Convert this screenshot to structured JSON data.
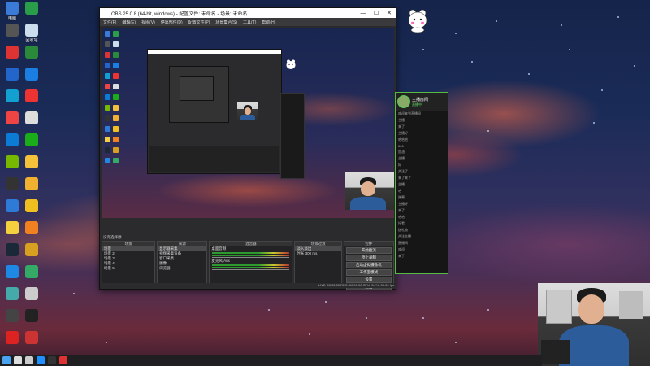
{
  "desktop": {
    "icons": [
      {
        "label": "电脑",
        "color": "#3b7bd8"
      },
      {
        "label": "",
        "color": "#2a9d4a"
      },
      {
        "label": "",
        "color": "#555"
      },
      {
        "label": "回收站",
        "color": "#cde"
      },
      {
        "label": "",
        "color": "#d33"
      },
      {
        "label": "",
        "color": "#2a8a3a"
      },
      {
        "label": "",
        "color": "#2266cc"
      },
      {
        "label": "",
        "color": "#1a7fe0"
      },
      {
        "label": "",
        "color": "#12a0d0"
      },
      {
        "label": "",
        "color": "#e33"
      },
      {
        "label": "",
        "color": "#e44"
      },
      {
        "label": "",
        "color": "#ddd"
      },
      {
        "label": "",
        "color": "#0b7bd6"
      },
      {
        "label": "",
        "color": "#1aad19"
      },
      {
        "label": "",
        "color": "#76b900"
      },
      {
        "label": "",
        "color": "#f3c23a"
      },
      {
        "label": "",
        "color": "#333"
      },
      {
        "label": "",
        "color": "#f0b030"
      },
      {
        "label": "",
        "color": "#2d7bd6"
      },
      {
        "label": "",
        "color": "#f0c020"
      },
      {
        "label": "",
        "color": "#f4d03f"
      },
      {
        "label": "",
        "color": "#f08020"
      },
      {
        "label": "",
        "color": "#1b2838"
      },
      {
        "label": "",
        "color": "#d8a020"
      },
      {
        "label": "",
        "color": "#1e88e5"
      },
      {
        "label": "",
        "color": "#3a6"
      },
      {
        "label": "",
        "color": "#4aa"
      },
      {
        "label": "",
        "color": "#ccc"
      },
      {
        "label": "",
        "color": "#444"
      },
      {
        "label": "",
        "color": "#222"
      },
      {
        "label": "",
        "color": "#d22"
      },
      {
        "label": "",
        "color": "#c33"
      }
    ]
  },
  "obs": {
    "window_title": "OBS 25.0.8 (64-bit, windows) - 配置文件: 未命名 - 场景: 未命名",
    "controls": {
      "minimize": "—",
      "maximize": "☐",
      "close": "✕"
    },
    "menu": [
      "文件(F)",
      "编辑(E)",
      "视图(V)",
      "停靠部件(D)",
      "配置文件(P)",
      "场景集合(S)",
      "工具(T)",
      "帮助(H)"
    ],
    "source_bar_label": "没有选择源",
    "docks": {
      "scenes": {
        "title": "场景",
        "items": [
          "场景",
          "场景 2",
          "场景 3",
          "场景 4",
          "场景 5"
        ]
      },
      "sources": {
        "title": "来源",
        "items": [
          "显示器采集",
          "视频采集设备",
          "窗口采集",
          "图像",
          "浏览器"
        ]
      },
      "mixer": {
        "title": "混音器",
        "channels": [
          "桌面音频",
          "麦克风/Aux"
        ]
      },
      "transitions": {
        "title": "场景过渡",
        "items": [
          "淡入淡出",
          "时长 300 ms"
        ]
      },
      "controls": {
        "title": "控件",
        "buttons": [
          "开始推流",
          "停止录制",
          "启动虚拟摄像机",
          "工作室模式",
          "设置",
          "退出"
        ]
      }
    },
    "status": "LIVE: 00:00:00   REC: 00:00:00   CPU: 3.2%, 30.00 fps"
  },
  "chat": {
    "streamer_name": "主播房间",
    "subtitle": "直播中",
    "lines": [
      "欢迎来到直播间",
      "主播",
      "来了",
      "主播好",
      "哈哈哈",
      "666",
      "加油",
      "主播",
      "好",
      "关注了",
      "来了来了",
      "主播",
      "哈",
      "弹幕",
      "主播好",
      "来了",
      "哈哈",
      "好看",
      "送礼物",
      "关注主播",
      "直播间",
      "欢迎",
      "来了"
    ]
  },
  "taskbar": {
    "items": [
      "start-icon",
      "search-icon",
      "taskview-icon",
      "edge-icon",
      "obs-icon",
      "app-icon"
    ],
    "colors": [
      "#4aa3f0",
      "#ddd",
      "#ccc",
      "#1e90ff",
      "#333",
      "#d33"
    ]
  }
}
